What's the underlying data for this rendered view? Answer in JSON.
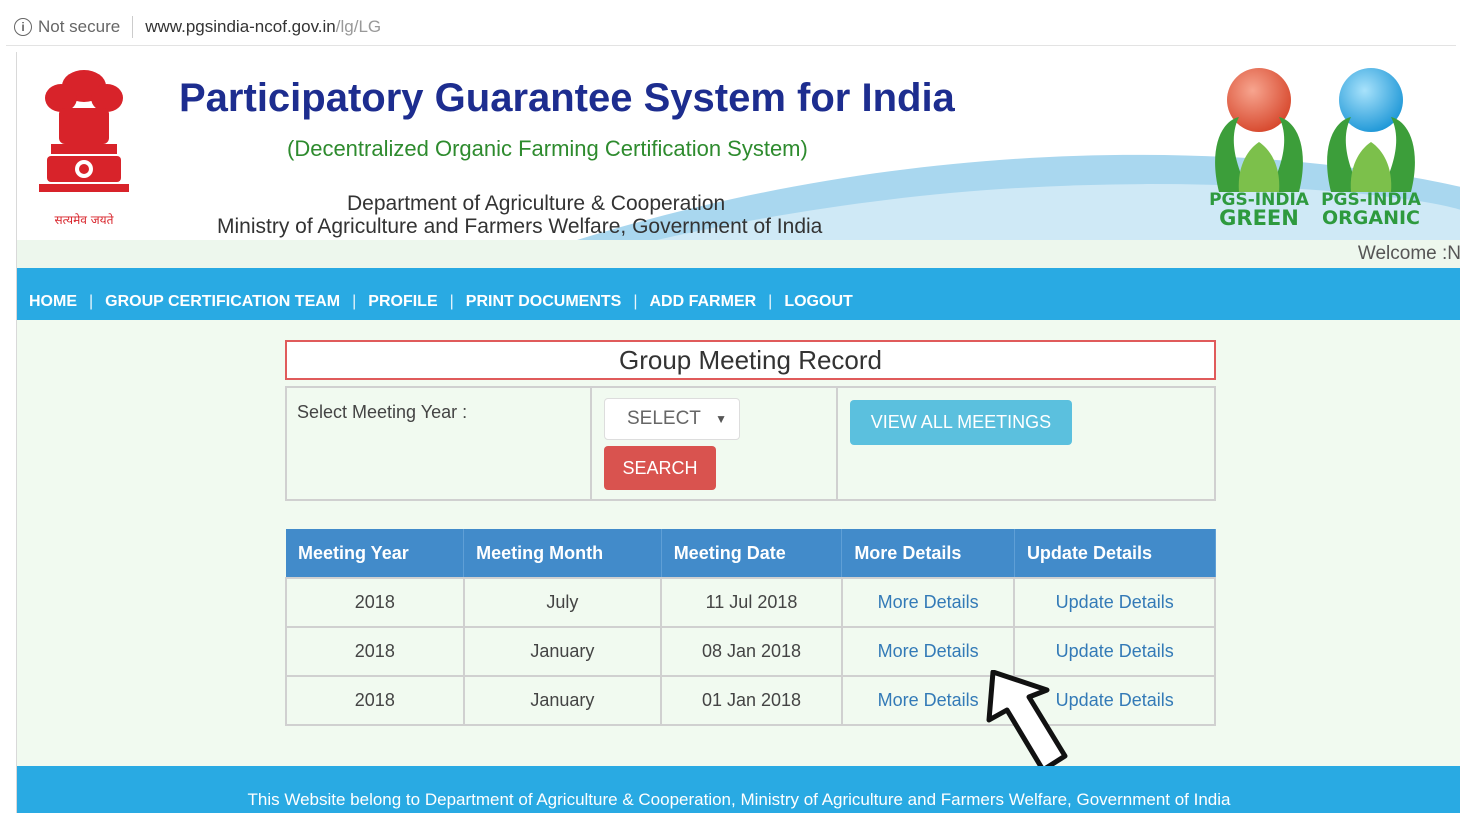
{
  "browser": {
    "security_label": "Not secure",
    "url_host": "www.pgsindia-ncof.gov.in",
    "url_path": "/lg/LG"
  },
  "header": {
    "title": "Participatory Guarantee System for India",
    "subtitle": "(Decentralized Organic Farming Certification System)",
    "department": "Department of Agriculture & Cooperation",
    "ministry": "Ministry of Agriculture and Farmers Welfare, Government of India",
    "emblem_motto": "सत्यमेव जयते",
    "logo_green": [
      "PGS-INDIA",
      "GREEN"
    ],
    "logo_organic": [
      "PGS-INDIA",
      "ORGANIC"
    ],
    "welcome": "Welcome :N"
  },
  "nav": {
    "items": [
      "HOME",
      "GROUP CERTIFICATION TEAM",
      "PROFILE",
      "PRINT DOCUMENTS",
      "ADD FARMER",
      "LOGOUT"
    ]
  },
  "form": {
    "title": "Group Meeting Record",
    "year_label": "Select Meeting Year :",
    "select_value": "SELECT",
    "search_button": "SEARCH",
    "view_all_button": "VIEW ALL MEETINGS"
  },
  "table": {
    "headers": [
      "Meeting Year",
      "Meeting Month",
      "Meeting Date",
      "More Details",
      "Update Details"
    ],
    "rows": [
      [
        "2018",
        "July",
        "11 Jul 2018",
        "More Details",
        "Update Details"
      ],
      [
        "2018",
        "January",
        "08 Jan 2018",
        "More Details",
        "Update Details"
      ],
      [
        "2018",
        "January",
        "01 Jan 2018",
        "More Details",
        "Update Details"
      ]
    ]
  },
  "footer": {
    "text": "This Website belong to Department of Agriculture & Cooperation, Ministry of Agriculture and Farmers Welfare, Government of India"
  },
  "colors": {
    "title_blue": "#1d2d8f",
    "nav_blue": "#29aae3",
    "search_red": "#d9534f",
    "view_all_cyan": "#5bc0de",
    "table_header_blue": "#428bca",
    "link_blue": "#337ab7"
  }
}
